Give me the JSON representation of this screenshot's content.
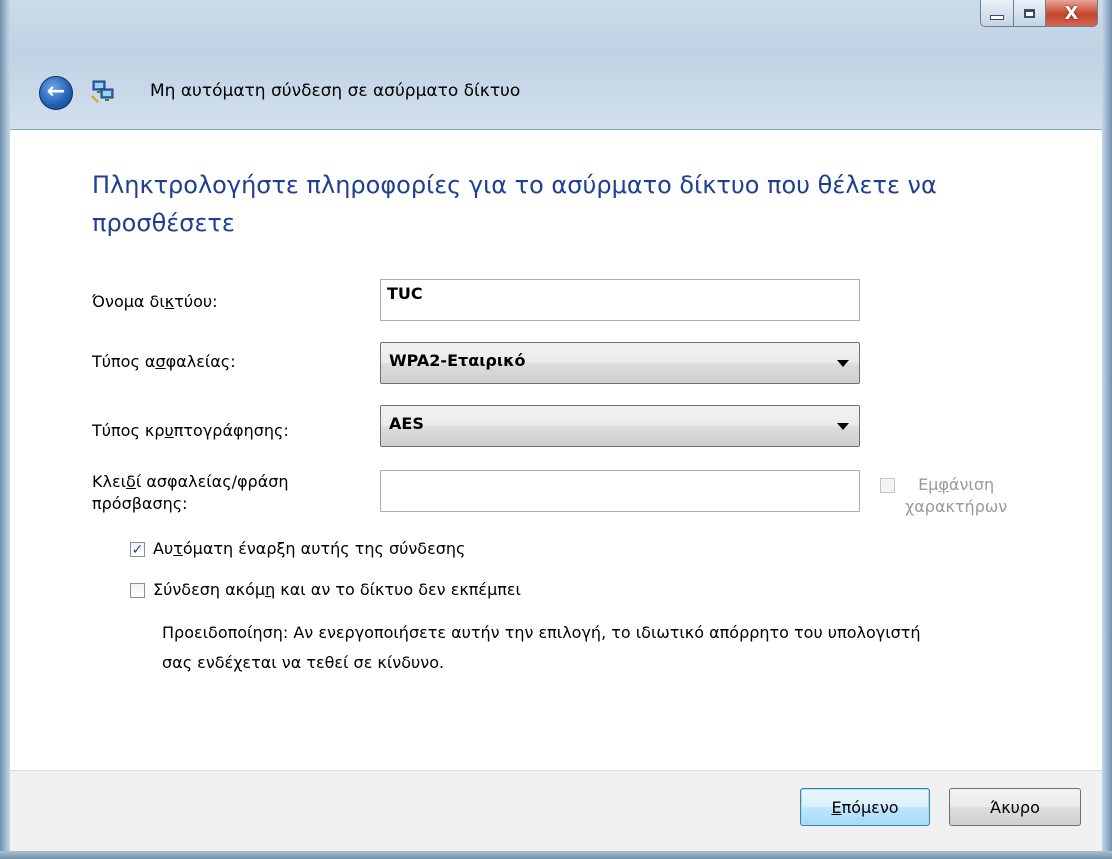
{
  "window": {
    "title": "Μη αυτόματη σύνδεση σε ασύρματο δίκτυο",
    "caption_buttons": {
      "minimize": "minimize-icon",
      "maximize": "maximize-icon",
      "close": "close-icon"
    },
    "close_glyph": "X",
    "back_icon": "back-arrow-icon",
    "network_icon": "wireless-network-icon"
  },
  "form": {
    "heading": "Πληκτρολογήστε πληροφορίες για το ασύρματο δίκτυο που θέλετε να προσθέσετε",
    "network_name": {
      "label_pre": "Όνομα δι",
      "label_accel": "κ",
      "label_post": "τύου:",
      "value": "TUC"
    },
    "security_type": {
      "label_pre": "Τύπος α",
      "label_accel": "σ",
      "label_post": "φαλείας:",
      "value": "WPA2-Εταιρικό"
    },
    "encryption_type": {
      "label_pre": "Τύπος κρ",
      "label_accel": "υ",
      "label_post": "πτογράφησης:",
      "value": "AES"
    },
    "security_key": {
      "label_line1_pre": "Κλει",
      "label_line1_accel": "δ",
      "label_line1_post": "ί ασφαλείας/φράση",
      "label_line2": "πρόσβασης:",
      "value": "",
      "show_chars_pre": "Εμ",
      "show_chars_accel": "φ",
      "show_chars_post": "άνιση",
      "show_chars_line2": "χαρακτήρων",
      "show_chars_checked": false,
      "show_chars_enabled": false
    },
    "auto_start": {
      "label_pre": "Αυ",
      "label_accel": "τ",
      "label_post": "όματη έναρξη αυτής της σύνδεσης",
      "checked": true
    },
    "connect_hidden": {
      "label_pre": "Σύνδεση ακόμ",
      "label_accel": "η",
      "label_post": " και αν το δίκτυο δεν εκπέμπει",
      "checked": false
    },
    "warning_line1": "Προειδοποίηση: Αν ενεργοποιήσετε αυτήν την επιλογή, το ιδιωτικό απόρρητο του υπολογιστή",
    "warning_line2": "σας ενδέχεται να τεθεί σε κίνδυνο."
  },
  "footer": {
    "next_accel": "Ε",
    "next_rest": "πόμενο",
    "cancel_label": "Άκυρο"
  },
  "checkmark": "✓"
}
